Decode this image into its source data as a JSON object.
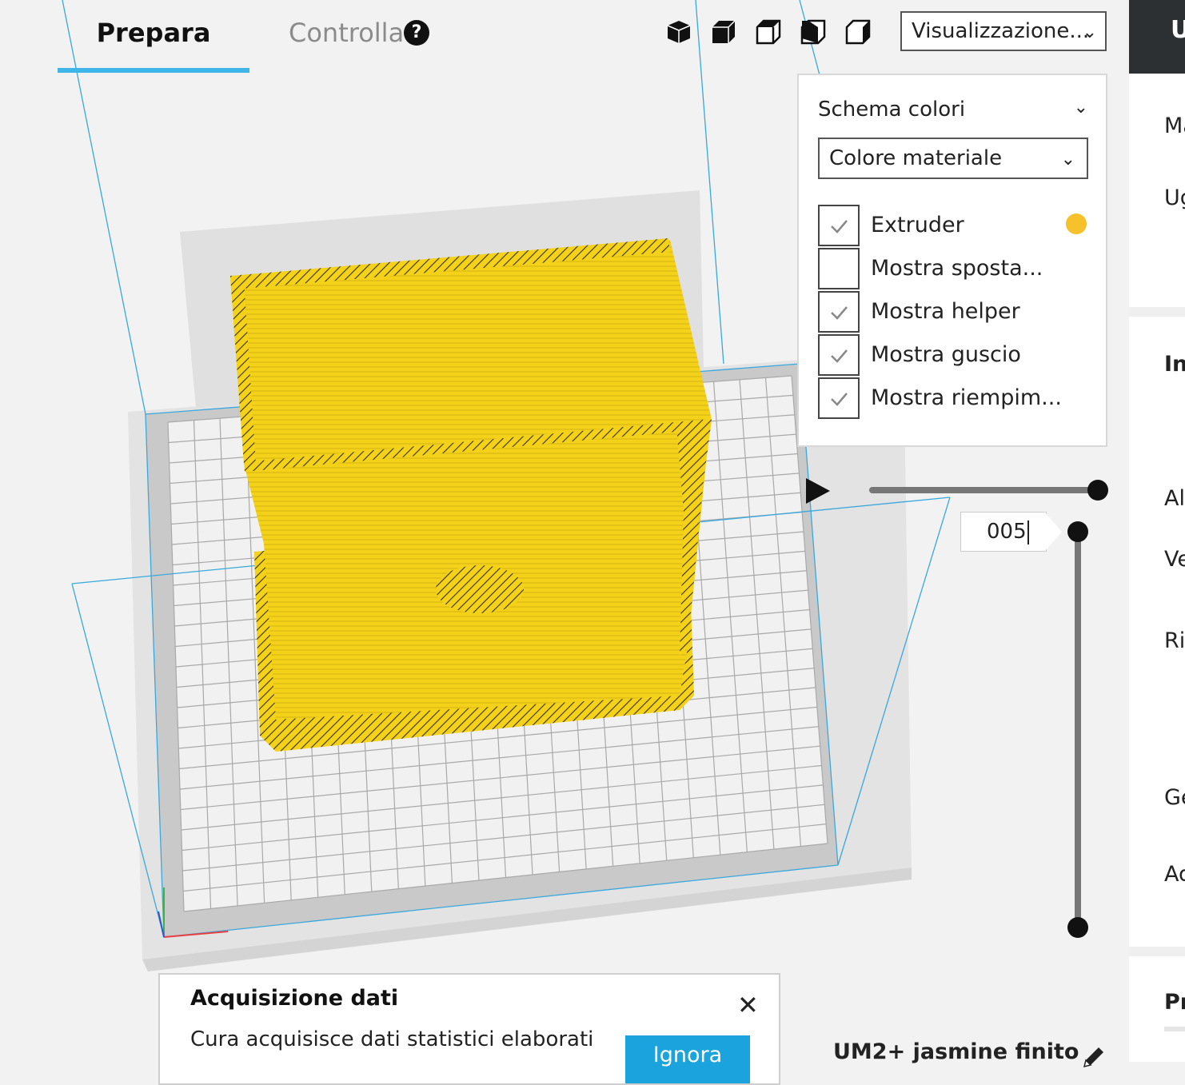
{
  "tabs": {
    "prepare": "Prepara",
    "monitor": "Controlla"
  },
  "view_select": {
    "value": "Visualizzazione..."
  },
  "panel": {
    "scheme_label": "Schema colori",
    "color_select": "Colore materiale",
    "options": [
      {
        "label": "Extruder",
        "checked": true
      },
      {
        "label": "Mostra sposta...",
        "checked": false
      },
      {
        "label": "Mostra helper",
        "checked": true
      },
      {
        "label": "Mostra guscio",
        "checked": true
      },
      {
        "label": "Mostra riempim...",
        "checked": true
      }
    ],
    "extruder_color": "#f7c12b"
  },
  "layer": {
    "value": "005"
  },
  "popup": {
    "title": "Acquisizione dati",
    "text": "Cura acquisisce dati statistici elaborati",
    "ignore_button": "Ignora"
  },
  "profile_name": "UM2+ jasmine finito",
  "sidebar": {
    "header": "U",
    "items": [
      "Ma",
      "Ug",
      "In",
      "Alt",
      "Ve",
      "Rie",
      "Ge",
      "Ad",
      "Pr"
    ]
  },
  "colors": {
    "accent": "#3fb6ea",
    "model": "#f5d21a",
    "button": "#1aa3dc",
    "header": "#2c3033"
  },
  "icons": [
    "help-icon",
    "view-3d-icon",
    "view-front-icon",
    "view-top-icon",
    "view-left-icon",
    "view-right-icon",
    "chevron-down-icon",
    "check-icon",
    "play-icon",
    "close-icon",
    "pencil-icon"
  ]
}
